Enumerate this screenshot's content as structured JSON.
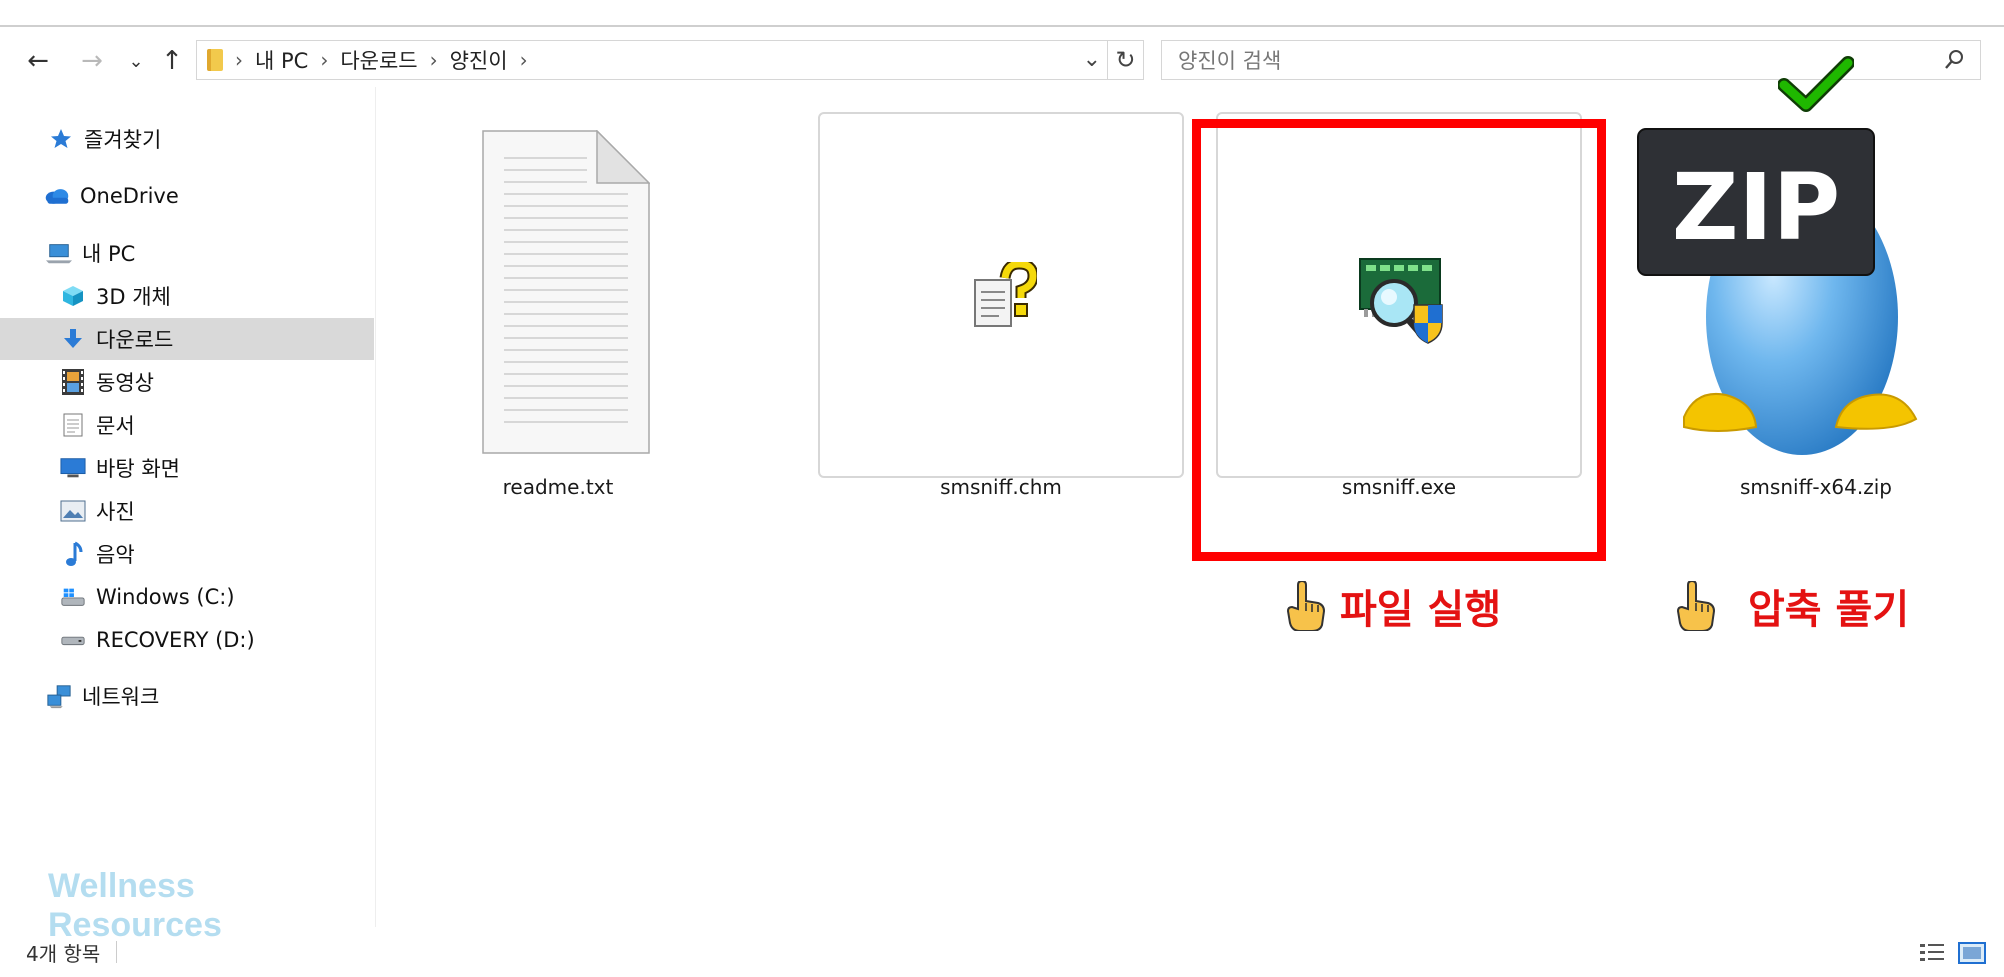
{
  "address": {
    "crumbs": [
      "내 PC",
      "다운로드",
      "양진이"
    ]
  },
  "search": {
    "placeholder": "양진이 검색"
  },
  "sidebar": {
    "items": [
      {
        "label": "즐겨찾기",
        "icon": "star-icon"
      },
      {
        "label": "OneDrive",
        "icon": "cloud-icon"
      },
      {
        "label": "내 PC",
        "icon": "pc-icon"
      },
      {
        "label": "3D 개체",
        "icon": "cube-icon"
      },
      {
        "label": "다운로드",
        "icon": "download-icon",
        "selected": true
      },
      {
        "label": "동영상",
        "icon": "film-icon"
      },
      {
        "label": "문서",
        "icon": "document-icon"
      },
      {
        "label": "바탕 화면",
        "icon": "desktop-icon"
      },
      {
        "label": "사진",
        "icon": "picture-icon"
      },
      {
        "label": "음악",
        "icon": "music-icon"
      },
      {
        "label": "Windows (C:)",
        "icon": "windows-drive-icon"
      },
      {
        "label": "RECOVERY (D:)",
        "icon": "drive-icon"
      },
      {
        "label": "네트워크",
        "icon": "network-icon"
      }
    ]
  },
  "watermark": "Wellness Resources",
  "files": [
    {
      "name": "readme.txt",
      "icon": "text-file-icon"
    },
    {
      "name": "smsniff.chm",
      "icon": "help-file-icon"
    },
    {
      "name": "smsniff.exe",
      "icon": "network-sniffer-icon"
    },
    {
      "name": "smsniff-x64.zip",
      "icon": "zip-archive-icon"
    }
  ],
  "annotations": {
    "run_file": "파일 실행",
    "extract": "압축 풀기"
  },
  "status": {
    "item_count": "4개 항목"
  },
  "colors": {
    "highlight": "#ff0000",
    "annotation_text": "#e41212",
    "checkmark": "#1fb800",
    "selected_nav": "#d9d9d9",
    "watermark": "#a8d8ee"
  }
}
